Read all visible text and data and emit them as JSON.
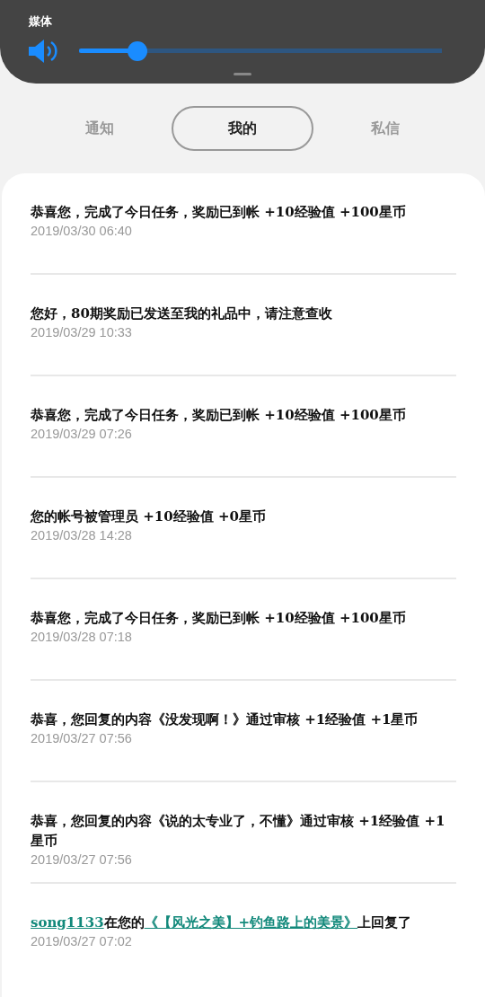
{
  "volume_panel": {
    "label": "媒体",
    "level": 0.16
  },
  "tabs": [
    {
      "label": "通知",
      "selected": false
    },
    {
      "label": "我的",
      "selected": true
    },
    {
      "label": "私信",
      "selected": false
    }
  ],
  "messages": [
    {
      "parts": [
        {
          "kind": "plain",
          "text": "恭喜您，完成了今日任务，奖励已到帐 +10经验值 +100星币"
        }
      ],
      "time": "2019/03/30 06:40"
    },
    {
      "parts": [
        {
          "kind": "plain",
          "text": "您好，80期奖励已发送至我的礼品中，请注意查收"
        }
      ],
      "time": "2019/03/29 10:33"
    },
    {
      "parts": [
        {
          "kind": "plain",
          "text": "恭喜您，完成了今日任务，奖励已到帐 +10经验值 +100星币"
        }
      ],
      "time": "2019/03/29 07:26"
    },
    {
      "parts": [
        {
          "kind": "plain",
          "text": "您的帐号被管理员 +10经验值 +0星币"
        }
      ],
      "time": "2019/03/28 14:28"
    },
    {
      "parts": [
        {
          "kind": "plain",
          "text": "恭喜您，完成了今日任务，奖励已到帐 +10经验值 +100星币"
        }
      ],
      "time": "2019/03/28 07:18"
    },
    {
      "parts": [
        {
          "kind": "plain",
          "text": "恭喜，您回复的内容《没发现啊！》通过审核 +1经验值 +1星币"
        }
      ],
      "time": "2019/03/27 07:56"
    },
    {
      "parts": [
        {
          "kind": "plain",
          "text": "恭喜，您回复的内容《说的太专业了，不懂》通过审核 +1经验值 +1星币"
        }
      ],
      "time": "2019/03/27 07:56"
    },
    {
      "parts": [
        {
          "kind": "link",
          "text": "song1133"
        },
        {
          "kind": "plain",
          "text": "在您的"
        },
        {
          "kind": "link",
          "text": "《【风光之美】+钓鱼路上的美景》"
        },
        {
          "kind": "plain",
          "text": "上回复了"
        }
      ],
      "time": "2019/03/27 07:02"
    }
  ]
}
